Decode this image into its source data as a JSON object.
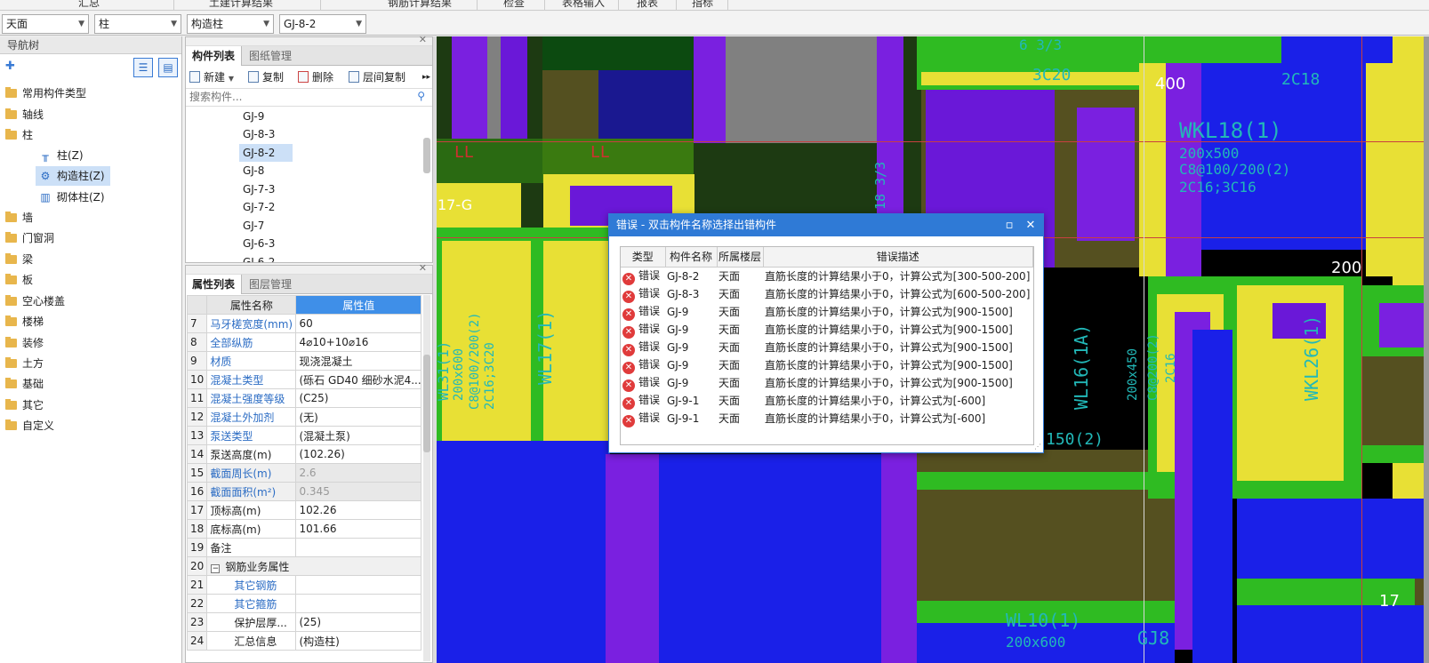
{
  "top_menu": [
    "汇总",
    "土建计算结果",
    "钢筋计算结果",
    "检查",
    "表格输入",
    "报表",
    "指标"
  ],
  "selectors": {
    "floor": "天面",
    "category": "柱",
    "type": "构造柱",
    "component": "GJ-8-2"
  },
  "nav": {
    "title": "导航树",
    "items": [
      {
        "label": "常用构件类型"
      },
      {
        "label": "轴线"
      },
      {
        "label": "柱"
      },
      {
        "label": "柱(Z)"
      },
      {
        "label": "构造柱(Z)"
      },
      {
        "label": "砌体柱(Z)"
      },
      {
        "label": "墙"
      },
      {
        "label": "门窗洞"
      },
      {
        "label": "梁"
      },
      {
        "label": "板"
      },
      {
        "label": "空心楼盖"
      },
      {
        "label": "楼梯"
      },
      {
        "label": "装修"
      },
      {
        "label": "土方"
      },
      {
        "label": "基础"
      },
      {
        "label": "其它"
      },
      {
        "label": "自定义"
      }
    ]
  },
  "component_panel": {
    "tabs": [
      "构件列表",
      "图纸管理"
    ],
    "toolbar": {
      "new": "新建",
      "copy": "复制",
      "delete": "删除",
      "floor_copy": "层间复制"
    },
    "search_placeholder": "搜索构件...",
    "items": [
      "GJ-9",
      "GJ-8-3",
      "GJ-8-2",
      "GJ-8",
      "GJ-7-3",
      "GJ-7-2",
      "GJ-7",
      "GJ-6-3",
      "GJ-6-2"
    ]
  },
  "property_panel": {
    "tabs": [
      "属性列表",
      "图层管理"
    ],
    "header_name": "属性名称",
    "header_value": "属性值",
    "rows": [
      {
        "num": "7",
        "name": "马牙槎宽度(mm)",
        "value": "60"
      },
      {
        "num": "8",
        "name": "全部纵筋",
        "value": "4⌀10+10⌀16"
      },
      {
        "num": "9",
        "name": "材质",
        "value": "现浇混凝土"
      },
      {
        "num": "10",
        "name": "混凝土类型",
        "value": "(砾石 GD40 细砂水泥4..."
      },
      {
        "num": "11",
        "name": "混凝土强度等级",
        "value": "(C25)"
      },
      {
        "num": "12",
        "name": "混凝土外加剂",
        "value": "(无)"
      },
      {
        "num": "13",
        "name": "泵送类型",
        "value": "(混凝土泵)"
      },
      {
        "num": "14",
        "name": "泵送高度(m)",
        "value": "(102.26)"
      },
      {
        "num": "15",
        "name": "截面周长(m)",
        "value": "2.6"
      },
      {
        "num": "16",
        "name": "截面面积(m²)",
        "value": "0.345"
      },
      {
        "num": "17",
        "name": "顶标高(m)",
        "value": "102.26"
      },
      {
        "num": "18",
        "name": "底标高(m)",
        "value": "101.66"
      },
      {
        "num": "19",
        "name": "备注",
        "value": ""
      },
      {
        "num": "20",
        "name": "钢筋业务属性",
        "value": ""
      },
      {
        "num": "21",
        "name": "其它钢筋",
        "value": ""
      },
      {
        "num": "22",
        "name": "其它箍筋",
        "value": ""
      },
      {
        "num": "23",
        "name": "保护层厚...",
        "value": "(25)"
      },
      {
        "num": "24",
        "name": "汇总信息",
        "value": "(构造柱)"
      }
    ]
  },
  "cad_labels": {
    "ll1": "LL",
    "ll2": "LL",
    "axis_g": "17-G",
    "d400": "400",
    "d200": "200",
    "wkl18": "WKL18(1)",
    "wkl18_size": "200x500",
    "wkl18_rebar": "C8@100/200(2)",
    "wkl18_main": "2C16;3C16",
    "wl17": "WL17(1)",
    "wl31": "WL31(1)",
    "wl31_size": "200x600",
    "wl31_rebar": "C8@100/200(2)",
    "wl31_main": "2C16;3C20",
    "wl16": "WL16(1A)",
    "wl16_size": "200x450",
    "wl16_rebar": "C8@200(2)",
    "wl16_main": "2C16",
    "wkl26": "WKL26(1)",
    "wl10": "WL10(1)",
    "wl10_size": "200x600",
    "gj8": "GJ8",
    "s150": "150(2)",
    "c3": "3C20",
    "c2": "2C18",
    "c18": "18 3/3",
    "top1": "6 3/3",
    "n17": "17"
  },
  "error_dialog": {
    "title": "错误 - 双击构件名称选择出错构件",
    "columns": [
      "类型",
      "构件名称",
      "所属楼层",
      "错误描述"
    ],
    "rows": [
      {
        "type": "错误",
        "name": "GJ-8-2",
        "floor": "天面",
        "desc": "直筋长度的计算结果小于0，计算公式为[300-500-200]"
      },
      {
        "type": "错误",
        "name": "GJ-8-3",
        "floor": "天面",
        "desc": "直筋长度的计算结果小于0，计算公式为[600-500-200]"
      },
      {
        "type": "错误",
        "name": "GJ-9",
        "floor": "天面",
        "desc": "直筋长度的计算结果小于0，计算公式为[900-1500]"
      },
      {
        "type": "错误",
        "name": "GJ-9",
        "floor": "天面",
        "desc": "直筋长度的计算结果小于0，计算公式为[900-1500]"
      },
      {
        "type": "错误",
        "name": "GJ-9",
        "floor": "天面",
        "desc": "直筋长度的计算结果小于0，计算公式为[900-1500]"
      },
      {
        "type": "错误",
        "name": "GJ-9",
        "floor": "天面",
        "desc": "直筋长度的计算结果小于0，计算公式为[900-1500]"
      },
      {
        "type": "错误",
        "name": "GJ-9",
        "floor": "天面",
        "desc": "直筋长度的计算结果小于0，计算公式为[900-1500]"
      },
      {
        "type": "错误",
        "name": "GJ-9-1",
        "floor": "天面",
        "desc": "直筋长度的计算结果小于0，计算公式为[-600]"
      },
      {
        "type": "错误",
        "name": "GJ-9-1",
        "floor": "天面",
        "desc": "直筋长度的计算结果小于0，计算公式为[-600]"
      }
    ]
  }
}
